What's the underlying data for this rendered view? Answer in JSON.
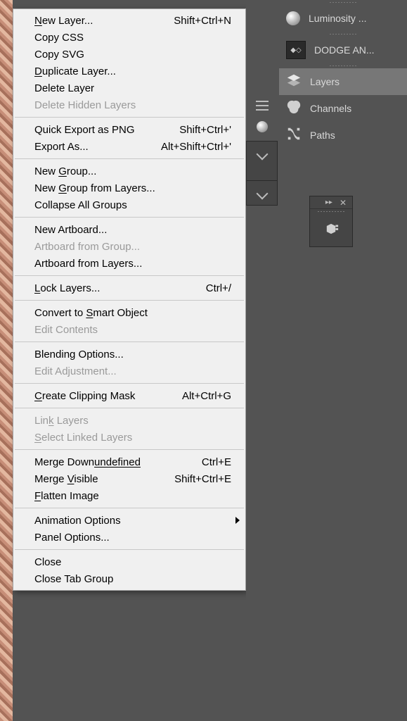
{
  "menu": {
    "groups": [
      [
        {
          "label_html": "New Layer...",
          "shortcut": "Shift+Ctrl+N",
          "u": 0
        },
        {
          "label_html": "Copy CSS"
        },
        {
          "label_html": "Copy SVG"
        },
        {
          "label_html": "Duplicate Layer...",
          "u": 0
        },
        {
          "label_html": "Delete Layer"
        },
        {
          "label_html": "Delete Hidden Layers",
          "disabled": true
        }
      ],
      [
        {
          "label_html": "Quick Export as PNG",
          "shortcut": "Shift+Ctrl+'"
        },
        {
          "label_html": "Export As...",
          "shortcut": "Alt+Shift+Ctrl+'"
        }
      ],
      [
        {
          "label_html": "New Group...",
          "u": 4
        },
        {
          "label_html": "New Group from Layers...",
          "u": 4
        },
        {
          "label_html": "Collapse All Groups"
        }
      ],
      [
        {
          "label_html": "New Artboard..."
        },
        {
          "label_html": "Artboard from Group...",
          "disabled": true
        },
        {
          "label_html": "Artboard from Layers..."
        }
      ],
      [
        {
          "label_html": "Lock Layers...",
          "shortcut": "Ctrl+/",
          "u": 0
        }
      ],
      [
        {
          "label_html": "Convert to Smart Object",
          "u": 11
        },
        {
          "label_html": "Edit Contents",
          "disabled": true
        }
      ],
      [
        {
          "label_html": "Blending Options..."
        },
        {
          "label_html": "Edit Adjustment...",
          "disabled": true
        }
      ],
      [
        {
          "label_html": "Create Clipping Mask",
          "shortcut": "Alt+Ctrl+G",
          "u": 0
        }
      ],
      [
        {
          "label_html": "Link Layers",
          "disabled": true,
          "u": 3
        },
        {
          "label_html": "Select Linked Layers",
          "disabled": true,
          "u": 0
        }
      ],
      [
        {
          "label_html": "Merge Down",
          "shortcut": "Ctrl+E",
          "u": 10
        },
        {
          "label_html": "Merge Visible",
          "shortcut": "Shift+Ctrl+E",
          "u": 6
        },
        {
          "label_html": "Flatten Image",
          "u": 0
        }
      ],
      [
        {
          "label_html": "Animation Options",
          "submenu": true
        },
        {
          "label_html": "Panel Options..."
        }
      ],
      [
        {
          "label_html": "Close"
        },
        {
          "label_html": "Close Tab Group"
        }
      ]
    ]
  },
  "sidebar": {
    "items": [
      {
        "label": "Luminosity ...",
        "icon": "radial"
      },
      {
        "label": "DODGE AN...",
        "icon": "thumb"
      },
      {
        "label": "Layers",
        "icon": "layers",
        "active": true
      },
      {
        "label": "Channels",
        "icon": "channels"
      },
      {
        "label": "Paths",
        "icon": "paths"
      }
    ]
  },
  "mini_panel": {
    "icon": "3d"
  }
}
